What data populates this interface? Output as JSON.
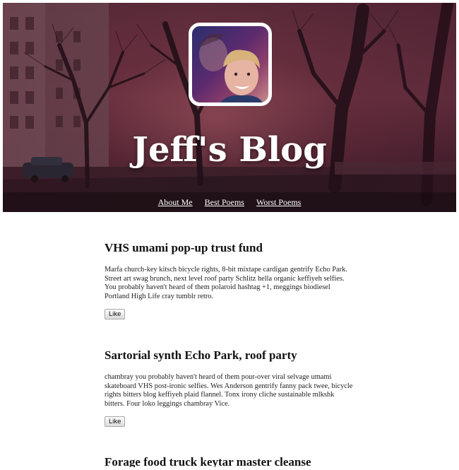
{
  "header": {
    "title": "Jeff's Blog",
    "nav": [
      {
        "label": "About Me"
      },
      {
        "label": "Best Poems"
      },
      {
        "label": "Worst Poems"
      }
    ]
  },
  "posts": [
    {
      "title": "VHS umami pop-up trust fund",
      "body": "Marfa church-key kitsch bicycle rights, 8-bit mixtape cardigan gentrify Echo Park. Street art swag brunch, next level roof party Schlitz hella organic keffiyeh selfies. You probably haven't heard of them polaroid hashtag +1, meggings biodiesel Portland High Life cray tumblr retro.",
      "like_label": "Like"
    },
    {
      "title": "Sartorial synth Echo Park, roof party",
      "body": "chambray you probably haven't heard of them pour-over viral selvage umami skateboard VHS post-ironic selfies. Wes Anderson gentrify fanny pack twee, bicycle rights bitters blog keffiyeh plaid flannel. Tonx irony cliche sustainable mlkshk bitters. Four loko leggings chambray Vice.",
      "like_label": "Like"
    },
    {
      "title": "Forage food truck keytar master cleanse",
      "body": "",
      "like_label": ""
    }
  ]
}
